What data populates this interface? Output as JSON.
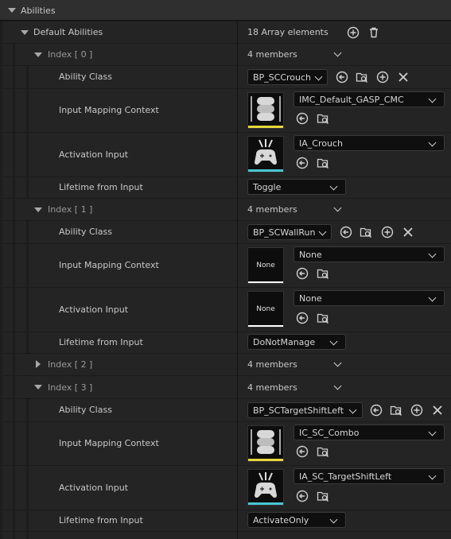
{
  "section": {
    "title": "Abilities"
  },
  "default_abilities": {
    "label": "Default Abilities",
    "summary": "18 Array elements"
  },
  "indices": [
    {
      "label": "Index [ 0 ]",
      "summary": "4 members"
    },
    {
      "label": "Index [ 1 ]",
      "summary": "4 members"
    },
    {
      "label": "Index [ 2 ]",
      "summary": "4 members"
    },
    {
      "label": "Index [ 3 ]",
      "summary": "4 members"
    }
  ],
  "prop_labels": {
    "ability_class": "Ability Class",
    "input_mapping_context": "Input Mapping Context",
    "activation_input": "Activation Input",
    "lifetime_from_input": "Lifetime from Input"
  },
  "values": {
    "i0_ability": "BP_SCCrouch",
    "i0_imc": "IMC_Default_GASP_CMC",
    "i0_activation": "IA_Crouch",
    "i0_lifetime": "Toggle",
    "i1_ability": "BP_SCWallRun",
    "i1_imc": "None",
    "i1_activation": "None",
    "i1_lifetime": "DoNotManage",
    "i3_ability": "BP_SCTargetShiftLeft",
    "i3_imc": "IC_SC_Combo",
    "i3_activation": "IA_SC_TargetShiftLeft",
    "i3_lifetime": "ActivateOnly"
  },
  "thumb_none_label": "None",
  "colors": {
    "imc_bar": "#e7d63a",
    "ia_bar": "#48c7d4",
    "accent_white": "#ffffff"
  },
  "icons": [
    "add-icon",
    "trash-icon",
    "use-selected-icon",
    "browse-icon",
    "clear-icon",
    "chevron-down-icon",
    "gamepad-icon"
  ]
}
